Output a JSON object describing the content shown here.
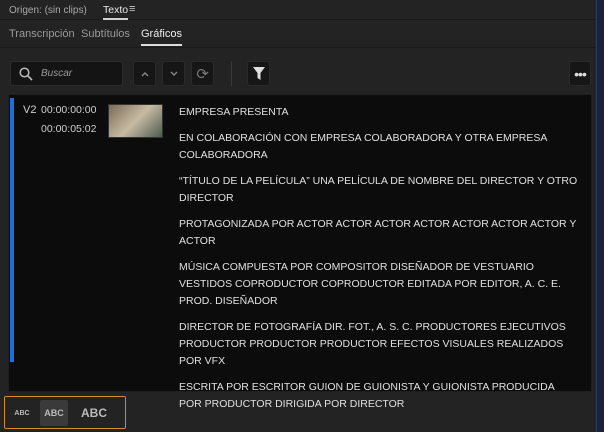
{
  "header": {
    "origin": "Origen: (sin clips)",
    "panel_title": "Texto",
    "menu_icon": "hamburger-icon"
  },
  "tabs": [
    {
      "label": "Transcripción"
    },
    {
      "label": "Subtítulos"
    },
    {
      "label": "Gráficos",
      "active": true
    }
  ],
  "toolbar": {
    "search_placeholder": "Buscar"
  },
  "items": [
    {
      "track": "V2",
      "start": "00:00:00:00",
      "end": "00:00:05:02",
      "lines": [
        "EMPRESA PRESENTA",
        "EN COLABORACIÓN CON EMPRESA COLABORADORA Y OTRA EMPRESA COLABORADORA",
        "“TÍTULO DE LA PELÍCULA” UNA PELÍCULA DE NOMBRE DEL DIRECTOR Y OTRO DIRECTOR",
        "PROTAGONIZADA POR ACTOR ACTOR ACTOR ACTOR ACTOR ACTOR ACTOR Y ACTOR",
        "MÚSICA COMPUESTA POR COMPOSITOR DISEÑADOR DE VESTUARIO VESTIDOS COPRODUCTOR COPRODUCTOR EDITADA POR EDITOR, A. C. E. PROD. DISEÑADOR",
        "DIRECTOR DE FOTOGRAFÍA DIR. FOT., A. S. C. PRODUCTORES EJECUTIVOS PRODUCTOR PRODUCTOR PRODUCTOR EFECTOS VISUALES REALIZADOS POR VFX",
        "ESCRITA POR ESCRITOR GUION DE GUIONISTA Y GUIONISTA PRODUCIDA POR PRODUCTOR DIRIGIDA POR DIRECTOR"
      ]
    }
  ],
  "font_sizes": [
    {
      "label": "ABC"
    },
    {
      "label": "ABC",
      "selected": true
    },
    {
      "label": "ABC"
    }
  ],
  "colors": {
    "accent": "#1e6fd9",
    "highlight": "#d48a1e"
  }
}
